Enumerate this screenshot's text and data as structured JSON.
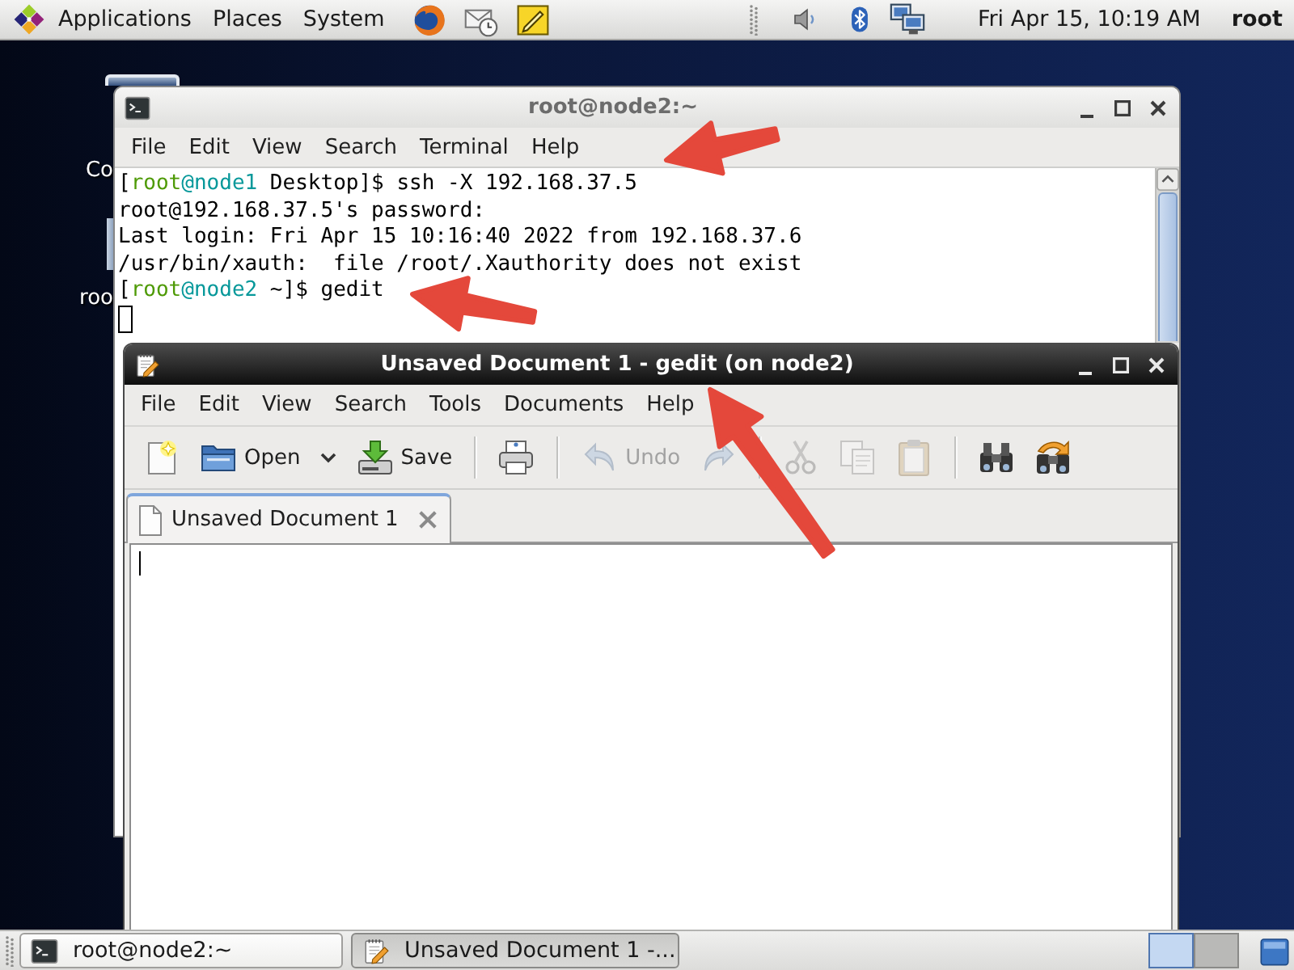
{
  "top_panel": {
    "menus": [
      "Applications",
      "Places",
      "System"
    ],
    "clock": "Fri Apr 15, 10:19 AM",
    "user": "root"
  },
  "desktop_icons": [
    {
      "label": "Co"
    },
    {
      "label": "roo"
    }
  ],
  "terminal": {
    "title": "root@node2:~",
    "active": false,
    "menus": [
      "File",
      "Edit",
      "View",
      "Search",
      "Terminal",
      "Help"
    ],
    "lines": [
      {
        "segments": [
          {
            "kind": "plain",
            "text": "["
          },
          {
            "kind": "user",
            "text": "root"
          },
          {
            "kind": "host",
            "text": "@node1"
          },
          {
            "kind": "plain",
            "text": " Desktop]$ ssh -X 192.168.37.5"
          }
        ]
      },
      {
        "segments": [
          {
            "kind": "plain",
            "text": "root@192.168.37.5's password:"
          }
        ]
      },
      {
        "segments": [
          {
            "kind": "plain",
            "text": "Last login: Fri Apr 15 10:16:40 2022 from 192.168.37.6"
          }
        ]
      },
      {
        "segments": [
          {
            "kind": "plain",
            "text": "/usr/bin/xauth:  file /root/.Xauthority does not exist"
          }
        ]
      },
      {
        "segments": [
          {
            "kind": "plain",
            "text": "["
          },
          {
            "kind": "user",
            "text": "root"
          },
          {
            "kind": "host",
            "text": "@node2"
          },
          {
            "kind": "plain",
            "text": " ~]$ gedit"
          }
        ]
      }
    ]
  },
  "gedit": {
    "title": "Unsaved Document 1 - gedit (on node2)",
    "active": true,
    "menus": [
      "File",
      "Edit",
      "View",
      "Search",
      "Tools",
      "Documents",
      "Help"
    ],
    "toolbar": [
      {
        "kind": "button",
        "disabled": false
      },
      {
        "kind": "menu-button",
        "label": "Open",
        "disabled": false
      },
      {
        "kind": "button",
        "label": "Save",
        "disabled": false
      },
      {
        "kind": "separator"
      },
      {
        "kind": "button",
        "disabled": false
      },
      {
        "kind": "separator"
      },
      {
        "kind": "button",
        "label": "Undo",
        "disabled": true
      },
      {
        "kind": "button",
        "disabled": true
      },
      {
        "kind": "separator"
      },
      {
        "kind": "button",
        "disabled": true
      },
      {
        "kind": "button",
        "disabled": true
      },
      {
        "kind": "button",
        "disabled": true
      },
      {
        "kind": "separator"
      },
      {
        "kind": "button",
        "disabled": false
      },
      {
        "kind": "button",
        "disabled": false
      }
    ],
    "tabs": [
      {
        "label": "Unsaved Document 1",
        "selected": true
      }
    ]
  },
  "taskbar": {
    "tasks": [
      {
        "label": "root@node2:~",
        "selected": false
      },
      {
        "label": "Unsaved Document 1 -...",
        "selected": true
      }
    ],
    "workspaces": [
      {
        "selected": true
      },
      {
        "selected": false
      }
    ]
  }
}
